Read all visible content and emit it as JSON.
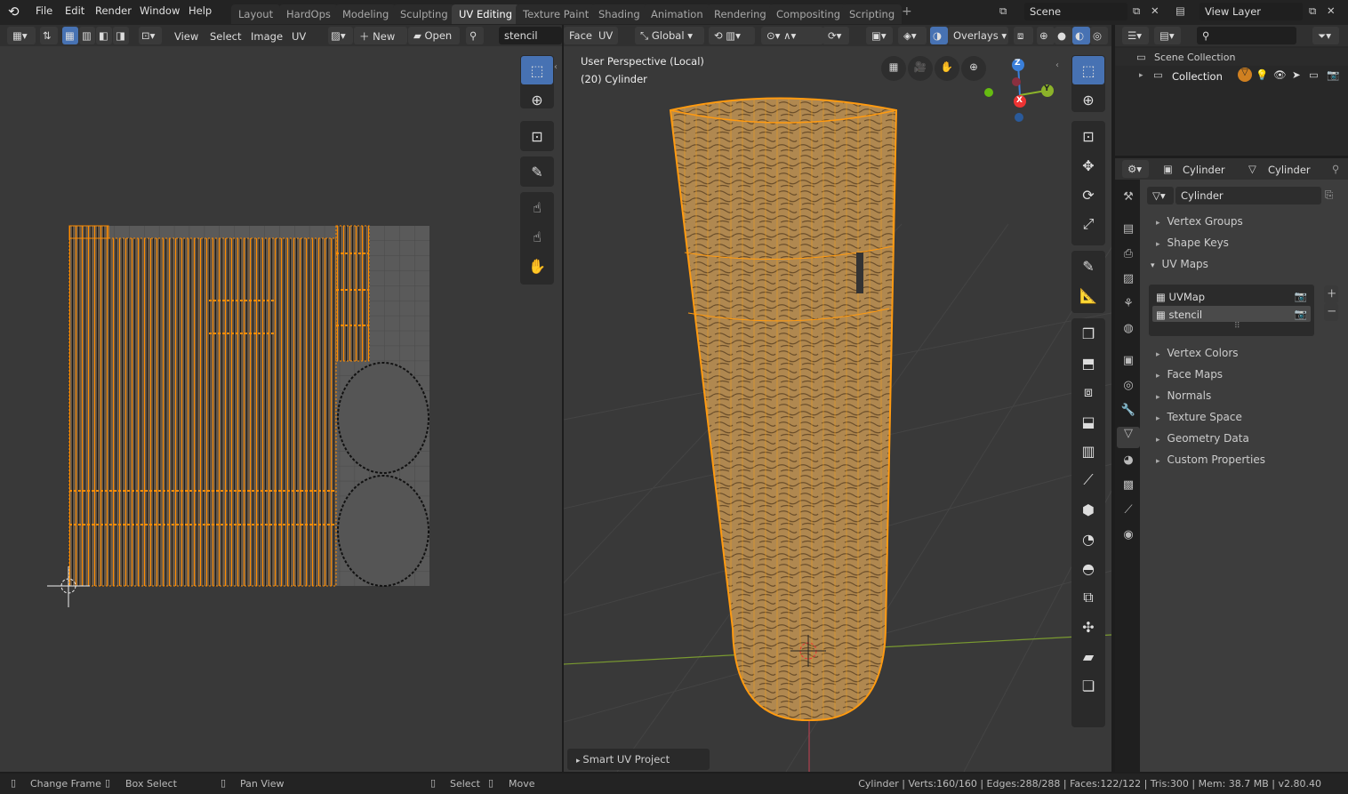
{
  "menus": [
    "File",
    "Edit",
    "Render",
    "Window",
    "Help"
  ],
  "workspace_tabs": [
    "Layout",
    "HardOps",
    "Modeling",
    "Sculpting",
    "UV Editing",
    "Texture Paint",
    "Shading",
    "Animation",
    "Rendering",
    "Compositing",
    "Scripting"
  ],
  "active_tab": "UV Editing",
  "scene": "Scene",
  "view_layer": "View Layer",
  "uv_editor": {
    "menus": [
      "View",
      "Select",
      "Image",
      "UV"
    ],
    "new_label": "New",
    "open_label": "Open",
    "image_name": "stencil"
  },
  "viewport": {
    "menus": [
      "Face",
      "UV"
    ],
    "orientation": "Global",
    "overlays_label": "Overlays",
    "info_line1": "User Perspective (Local)",
    "info_line2": "(20) Cylinder",
    "last_op": "Smart UV Project",
    "axes": {
      "z": "Z",
      "y": "Y",
      "x": "X"
    }
  },
  "outliner": {
    "search_placeholder": "",
    "scene_collection": "Scene Collection",
    "collection": "Collection"
  },
  "properties": {
    "object_name": "Cylinder",
    "mesh_name": "Cylinder",
    "data_name": "Cylinder",
    "sections_top": [
      "Vertex Groups",
      "Shape Keys",
      "UV Maps"
    ],
    "uv_maps": [
      "UVMap",
      "stencil"
    ],
    "active_uv_map": "stencil",
    "sections_bottom": [
      "Vertex Colors",
      "Face Maps",
      "Normals",
      "Texture Space",
      "Geometry Data",
      "Custom Properties"
    ]
  },
  "status": {
    "change_frame": "Change Frame",
    "box_select": "Box Select",
    "pan_view": "Pan View",
    "select": "Select",
    "move": "Move",
    "stats": "Cylinder | Verts:160/160 | Edges:288/288 | Faces:122/122 | Tris:300 | Mem: 38.7 MB | v2.80.40"
  },
  "colors": {
    "accent": "#4772b3",
    "selection": "#ff8c00",
    "background": "#393939"
  }
}
